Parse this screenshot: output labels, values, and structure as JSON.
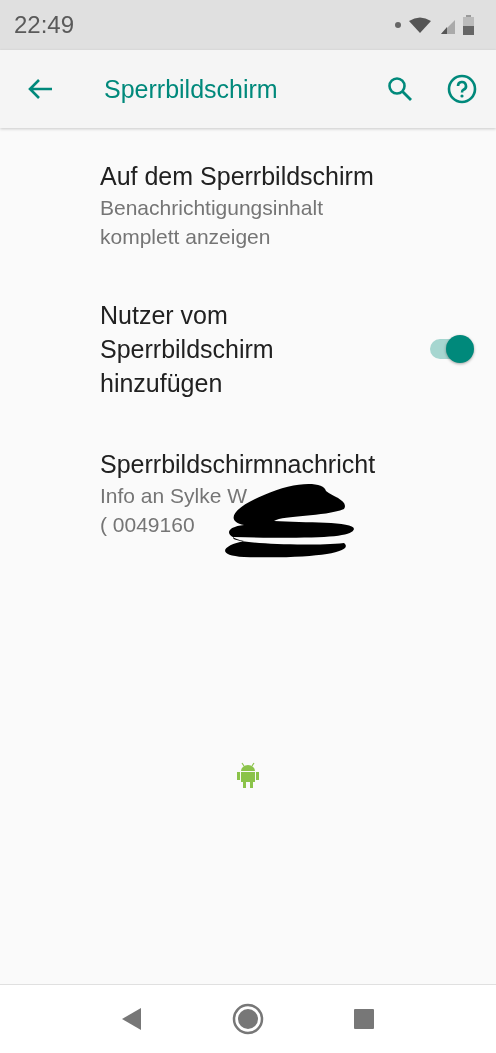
{
  "status_bar": {
    "time": "22:49"
  },
  "toolbar": {
    "title": "Sperrbildschirm"
  },
  "settings": [
    {
      "kind": "text",
      "title": "Auf dem Sperrbildschirm",
      "summary": [
        "Benachrichtigungsinhalt",
        "komplett anzeigen"
      ]
    },
    {
      "kind": "switch",
      "title": "Nutzer vom Sperrbildschirm hinzufügen",
      "on": true
    },
    {
      "kind": "redacted",
      "title": "Sperrbildschirmnachricht",
      "summary": [
        "Info an Sylke W",
        "( 0049160"
      ]
    }
  ]
}
